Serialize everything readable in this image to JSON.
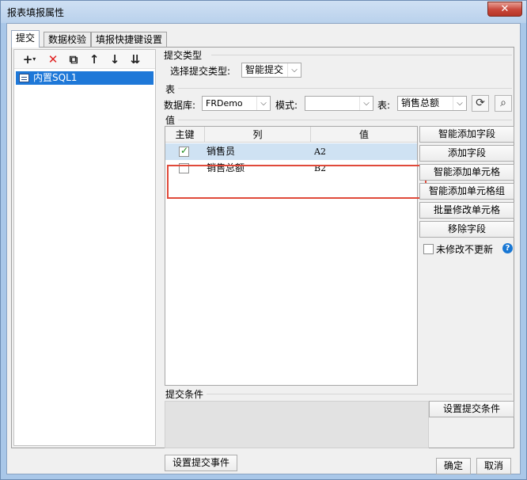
{
  "window": {
    "title": "报表填报属性",
    "close_icon": "✕"
  },
  "tabs": [
    "提交",
    "数据校验",
    "填报快捷键设置"
  ],
  "toolbar": {
    "add": "+",
    "delete": "✕",
    "copy": "⧉",
    "up": "↑",
    "down": "↓",
    "sort": "⇊"
  },
  "tree": {
    "item": "内置SQL1"
  },
  "submit_type": {
    "section": "提交类型",
    "label": "选择提交类型:",
    "value": "智能提交"
  },
  "table": {
    "section": "表",
    "db_label": "数据库:",
    "db_value": "FRDemo",
    "mode_label": "模式:",
    "mode_value": "",
    "table_label": "表:",
    "table_value": "销售总额"
  },
  "values": {
    "section": "值",
    "headers": [
      "主键",
      "列",
      "值"
    ],
    "rows": [
      {
        "key": true,
        "column": "销售员",
        "value": "A2"
      },
      {
        "key": false,
        "column": "销售总额",
        "value": "B2"
      }
    ]
  },
  "side_buttons": [
    "智能添加字段",
    "添加字段",
    "智能添加单元格",
    "智能添加单元格组",
    "批量修改单元格",
    "移除字段"
  ],
  "no_update": {
    "label": "未修改不更新",
    "checked": false,
    "help": "?"
  },
  "condition": {
    "section": "提交条件",
    "button": "设置提交条件"
  },
  "event_button": "设置提交事件",
  "footer": {
    "ok": "确定",
    "cancel": "取消"
  },
  "colors": {
    "selection": "#1e78d8",
    "highlight_border": "#e04a3a",
    "checkbox_check": "#1a8a1a"
  }
}
